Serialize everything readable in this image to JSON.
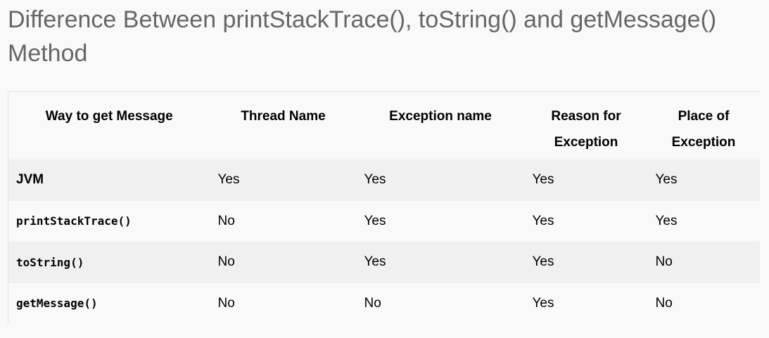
{
  "title": "Difference Between printStackTrace(), toString() and getMessage() Method",
  "table": {
    "headers": [
      "Way to get Message",
      "Thread Name",
      "Exception name",
      "Reason for Exception",
      "Place of Exception"
    ],
    "rows": [
      {
        "method": "JVM",
        "cells": [
          "Yes",
          "Yes",
          "Yes",
          "Yes"
        ]
      },
      {
        "method": "printStackTrace()",
        "cells": [
          "No",
          "Yes",
          "Yes",
          "Yes"
        ]
      },
      {
        "method": "toString()",
        "cells": [
          "No",
          "Yes",
          "Yes",
          "No"
        ]
      },
      {
        "method": "getMessage()",
        "cells": [
          "No",
          "No",
          "Yes",
          "No"
        ]
      }
    ]
  }
}
